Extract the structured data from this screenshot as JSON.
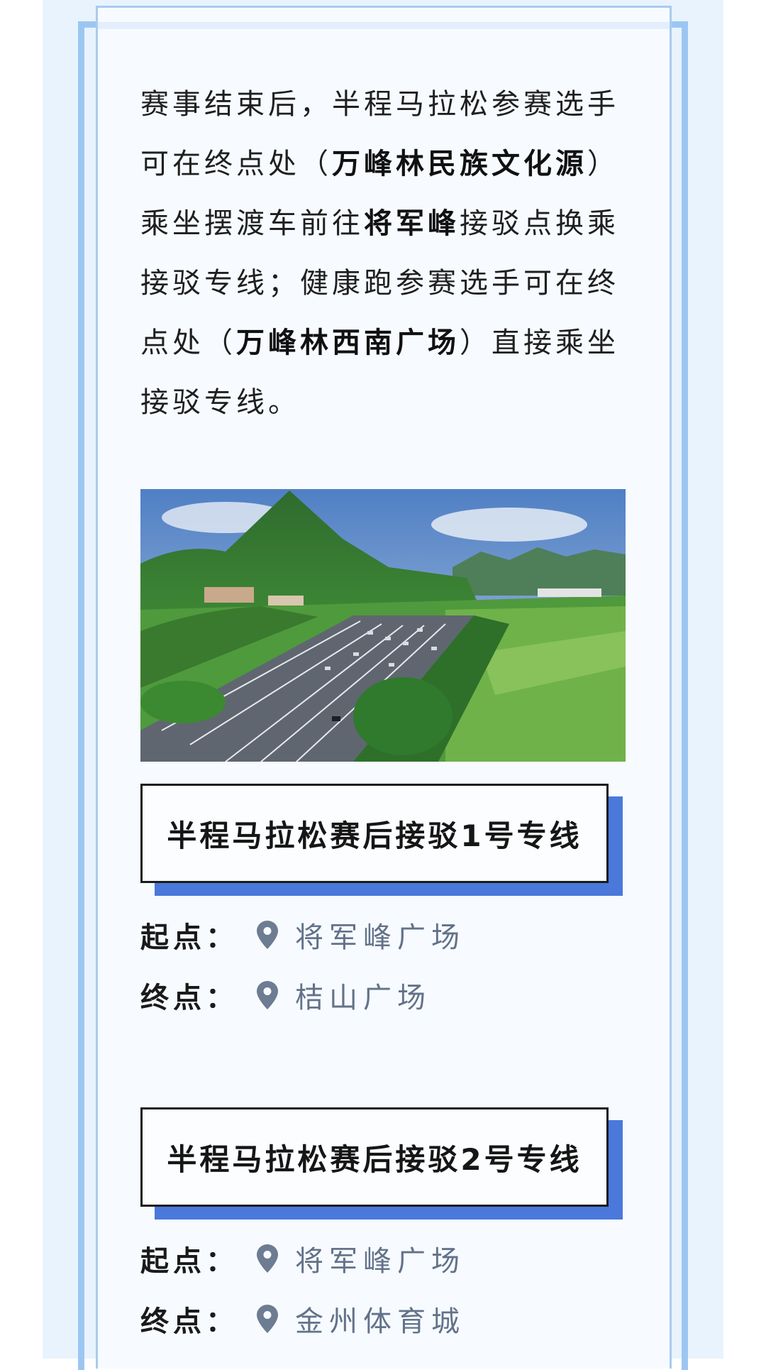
{
  "intro": {
    "seg1": "赛事结束后，半程马拉松参赛选手可在终点处（",
    "bold1": "万峰林民族文化源",
    "seg2": "）乘坐摆渡车前往",
    "bold2": "将军峰",
    "seg3": "接驳点换乘接驳专线；健康跑参赛选手可在终点处（",
    "bold3": "万峰林西南广场",
    "seg4": "）直接乘坐接驳专线。"
  },
  "routes": [
    {
      "title": "半程马拉松赛后接驳1号专线",
      "start_label": "起点：",
      "start_value": "将军峰广场",
      "end_label": "终点：",
      "end_value": "桔山广场"
    },
    {
      "title": "半程马拉松赛后接驳2号专线",
      "start_label": "起点：",
      "start_value": "将军峰广场",
      "end_label": "终点：",
      "end_value": "金州体育城"
    }
  ],
  "colors": {
    "accent_blue": "#4a78db",
    "frame_blue": "#9cc6f2",
    "pin_gray": "#6d7c92"
  },
  "icons": {
    "location": "location-pin-icon"
  }
}
